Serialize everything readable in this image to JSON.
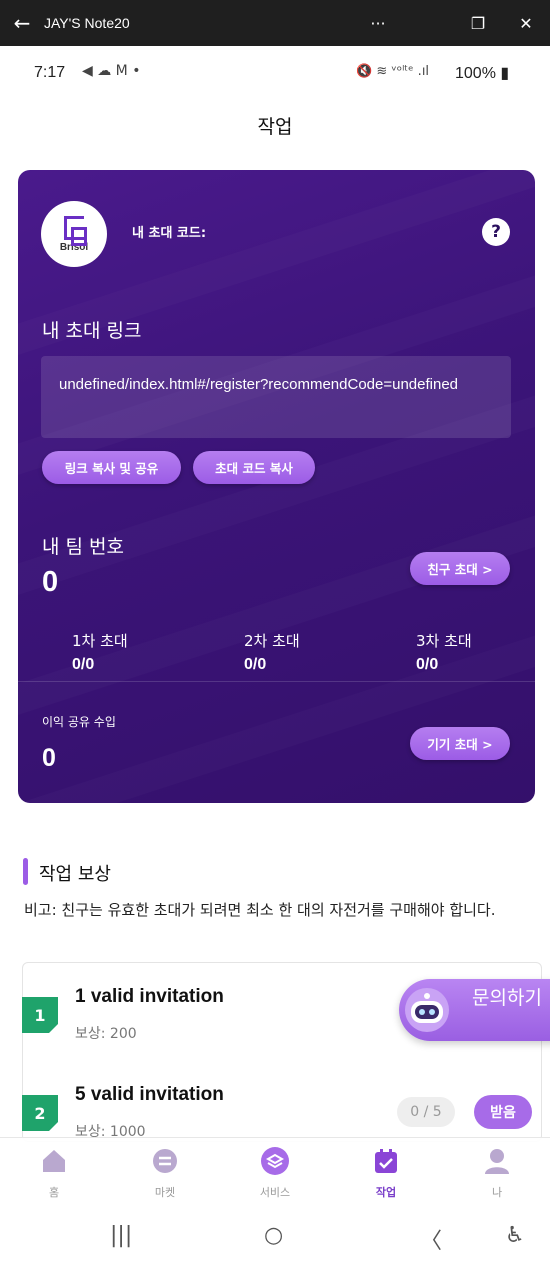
{
  "window": {
    "title": "JAY'S Note20",
    "back_glyph": "←",
    "menu_glyph": "···",
    "restore_glyph": "❐",
    "close_glyph": "✕"
  },
  "status": {
    "time": "7:17",
    "left_icons": "◀ ☁ M •",
    "right_icons": "🔇 ≋ ᵛᵒˡᵗᵉ .ıl",
    "battery": "100%"
  },
  "page": {
    "title": "작업"
  },
  "card": {
    "logo_text": "Brisol",
    "invite_code_label": "내 초대 코드:",
    "help_glyph": "?",
    "link_title": "내 초대 링크",
    "link_value": "undefined/index.html#/register?recommendCode=undefined",
    "copy_link_label": "링크 복사 및 공유",
    "copy_code_label": "초대 코드 복사",
    "team_title": "내 팀 번호",
    "team_count": "0",
    "invite_friend_label": "친구 초대 >",
    "tiers": [
      {
        "label": "1차 초대",
        "value": "0/0"
      },
      {
        "label": "2차 초대",
        "value": "0/0"
      },
      {
        "label": "3차 초대",
        "value": "0/0"
      }
    ],
    "profit_label": "이익 공유 수입",
    "profit_value": "0",
    "invite_device_label": "기기 초대 >"
  },
  "tasks": {
    "section_title": "작업 보상",
    "note": "비고: 친구는 유효한 초대가 되려면 최소 한 대의 자전거를 구매해야 합니다.",
    "items": [
      {
        "index": "1",
        "name": "1 valid invitation",
        "reward": "보상: 200"
      },
      {
        "index": "2",
        "name": "5 valid invitation",
        "reward": "보상: 1000",
        "progress": "0 / 5",
        "claim_label": "받음"
      }
    ],
    "contact_label": "문의하기"
  },
  "nav": {
    "items": [
      {
        "label": "홈",
        "icon": "home-icon"
      },
      {
        "label": "마켓",
        "icon": "market-icon"
      },
      {
        "label": "서비스",
        "icon": "service-icon"
      },
      {
        "label": "작업",
        "icon": "task-icon",
        "active": true
      },
      {
        "label": "나",
        "icon": "profile-icon"
      }
    ]
  },
  "system_nav": {
    "recents": "|||",
    "home": "○",
    "back": "〈",
    "accessibility": "♿"
  },
  "colors": {
    "card_purple": "#3b1478",
    "accent": "#9c5ce6",
    "badge_green": "#1fa36b"
  }
}
